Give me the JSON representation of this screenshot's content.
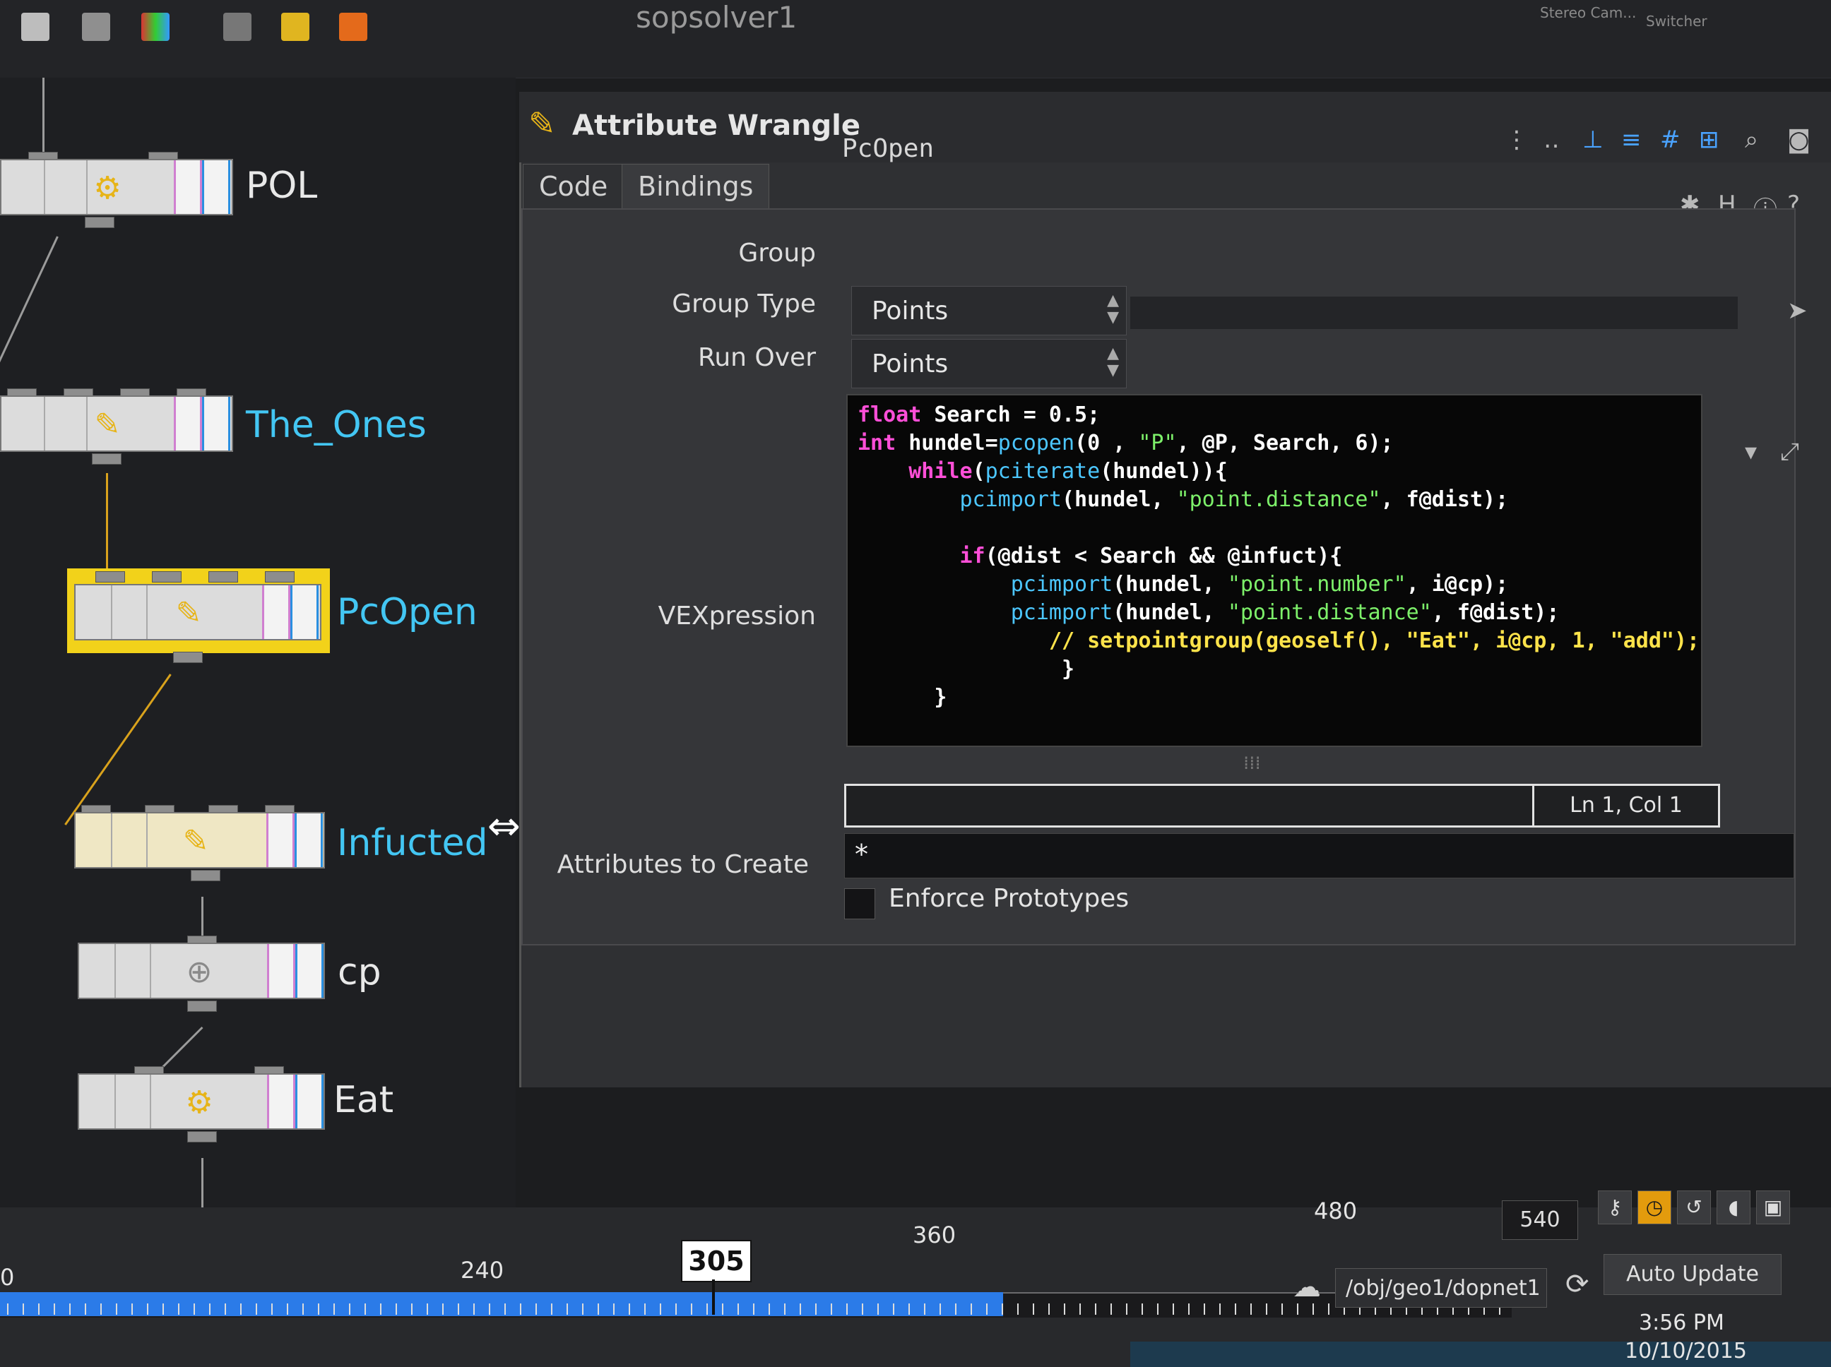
{
  "top_bar": {
    "title": "sopsolver1",
    "right_label_1": "Stereo Cam...",
    "right_label_2": "Switcher"
  },
  "network": {
    "nodes": [
      {
        "name": "POL",
        "label_color": "white",
        "icon": "gear-icon"
      },
      {
        "name": "The_Ones",
        "label_color": "blue",
        "icon": "wrangle-icon"
      },
      {
        "name": "PcOpen",
        "label_color": "blue",
        "icon": "wrangle-icon",
        "selected": true
      },
      {
        "name": "Infucted",
        "label_color": "blue",
        "icon": "wrangle-icon"
      },
      {
        "name": "cp",
        "label_color": "white",
        "icon": "add-point-icon"
      },
      {
        "name": "Eat",
        "label_color": "white",
        "icon": "gear-icon"
      }
    ]
  },
  "panel": {
    "node_type": "Attribute Wrangle",
    "node_name": "PcOpen",
    "tabs": [
      "Code",
      "Bindings"
    ],
    "params": {
      "group_label": "Group",
      "group_type_label": "Group Type",
      "group_type_value": "Points",
      "run_over_label": "Run Over",
      "run_over_value": "Points",
      "vexpression_label": "VEXpression",
      "attributes_label": "Attributes to Create",
      "attributes_value": "*",
      "enforce_label": "Enforce Prototypes"
    },
    "code_status": "Ln 1, Col 1",
    "code_lines": [
      "float Search = 0.5;",
      "int hundel=pcopen(0 , \"P\", @P, Search, 6);",
      "    while(pciterate(hundel)){",
      "        pcimport(hundel, \"point.distance\", f@dist);",
      "",
      "        if(@dist < Search && @infuct){",
      "            pcimport(hundel, \"point.number\", i@cp);",
      "            pcimport(hundel, \"point.distance\", f@dist);",
      "               // setpointgroup(geoself(), \"Eat\", i@cp, 1, \"add\");",
      "                }",
      "      }"
    ]
  },
  "timeline": {
    "labels": [
      "0",
      "240",
      "360",
      "480"
    ],
    "current_frame": "305",
    "end_frame": "540"
  },
  "footer": {
    "path": "/obj/geo1/dopnet1",
    "auto_update": "Auto Update",
    "time": "3:56 PM",
    "date": "10/10/2015"
  },
  "colors": {
    "selected_node": "#f2d21a",
    "node_label_blue": "#43c6f3",
    "timeline_range": "#2b7be8",
    "active_button": "#e39b0d"
  }
}
